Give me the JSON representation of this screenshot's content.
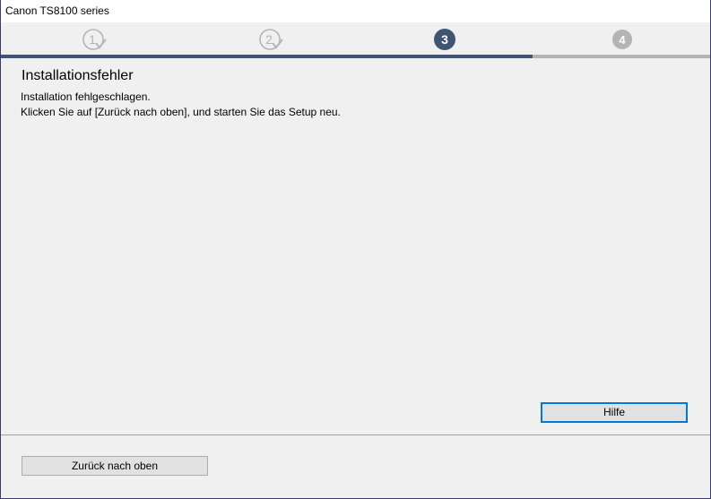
{
  "window": {
    "title": "Canon TS8100 series"
  },
  "steps": {
    "items": [
      {
        "label": "1",
        "state": "done"
      },
      {
        "label": "2",
        "state": "done"
      },
      {
        "label": "3",
        "state": "current"
      },
      {
        "label": "4",
        "state": "pending"
      }
    ],
    "progress": 0.75,
    "colors": {
      "done": "#b4b4b4",
      "current": "#3e5574",
      "pending": "#b4b4b4"
    }
  },
  "content": {
    "heading": "Installationsfehler",
    "message_line1": "Installation fehlgeschlagen.",
    "message_line2": "Klicken Sie auf [Zurück nach oben], und starten Sie das Setup neu."
  },
  "buttons": {
    "help_label": "Hilfe",
    "back_label": "Zurück nach oben"
  }
}
